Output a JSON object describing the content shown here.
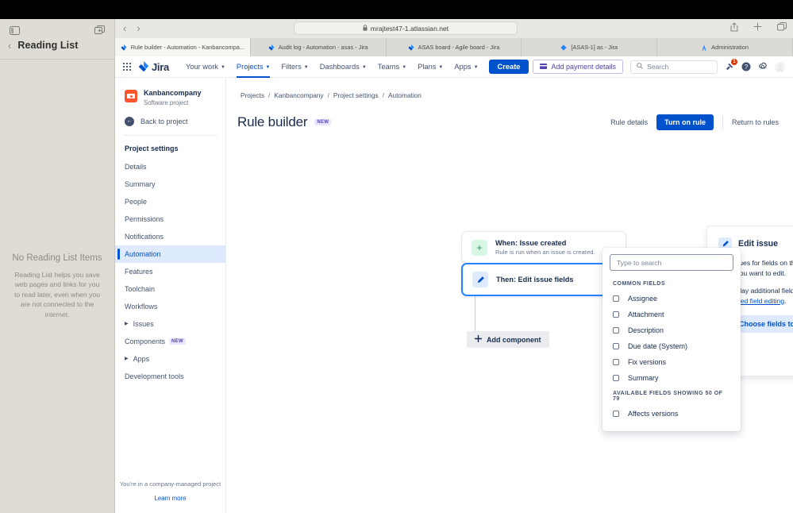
{
  "browser": {
    "sidebar": {
      "toolbar_icons": [
        "sidebar-toggle-icon",
        "new-tab-group-icon"
      ],
      "back_glyph": "‹",
      "title": "Reading List",
      "empty_title": "No Reading List Items",
      "empty_body": "Reading List helps you save web pages and links for you to read later, even when you are not connected to the internet."
    },
    "nav": {
      "back_glyph": "‹",
      "forward_glyph": "›",
      "reload_glyph": "↻"
    },
    "url": {
      "lock": "🔒",
      "value": "mrajtest47-1.atlassian.net"
    },
    "right_icons": [
      "share-icon",
      "new-tab-icon",
      "tab-overview-icon"
    ],
    "tabs": [
      {
        "title": "Rule builder - Automation - Kanbancompa...",
        "favicon": "jira",
        "active": true
      },
      {
        "title": "Audit log - Automation - asas - Jira",
        "favicon": "jira",
        "active": false
      },
      {
        "title": "ASAS board - Agile board - Jira",
        "favicon": "jira",
        "active": false
      },
      {
        "title": "[ASAS-1] as - Jira",
        "favicon": "issue",
        "active": false
      },
      {
        "title": "Administration",
        "favicon": "admin",
        "active": false
      }
    ]
  },
  "jira": {
    "topnav": {
      "product": "Jira",
      "items": [
        {
          "label": "Your work",
          "caret": true,
          "selected": false
        },
        {
          "label": "Projects",
          "caret": true,
          "selected": true
        },
        {
          "label": "Filters",
          "caret": true,
          "selected": false
        },
        {
          "label": "Dashboards",
          "caret": true,
          "selected": false
        },
        {
          "label": "Teams",
          "caret": true,
          "selected": false
        },
        {
          "label": "Plans",
          "caret": true,
          "selected": false
        },
        {
          "label": "Apps",
          "caret": true,
          "selected": false
        }
      ],
      "create_label": "Create",
      "payment_label": "Add payment details",
      "search_placeholder": "Search",
      "notification_count": "1",
      "right_icons": [
        "notifications-icon",
        "help-icon",
        "settings-icon",
        "avatar"
      ]
    },
    "sidebar": {
      "project_name": "Kanbancompany",
      "project_type": "Software project",
      "back_label": "Back to project",
      "section_title": "Project settings",
      "items": [
        {
          "label": "Details",
          "active": false,
          "expandable": false,
          "badge": ""
        },
        {
          "label": "Summary",
          "active": false,
          "expandable": false,
          "badge": ""
        },
        {
          "label": "People",
          "active": false,
          "expandable": false,
          "badge": ""
        },
        {
          "label": "Permissions",
          "active": false,
          "expandable": false,
          "badge": ""
        },
        {
          "label": "Notifications",
          "active": false,
          "expandable": false,
          "badge": ""
        },
        {
          "label": "Automation",
          "active": true,
          "expandable": false,
          "badge": ""
        },
        {
          "label": "Features",
          "active": false,
          "expandable": false,
          "badge": ""
        },
        {
          "label": "Toolchain",
          "active": false,
          "expandable": false,
          "badge": ""
        },
        {
          "label": "Workflows",
          "active": false,
          "expandable": false,
          "badge": ""
        },
        {
          "label": "Issues",
          "active": false,
          "expandable": true,
          "badge": ""
        },
        {
          "label": "Components",
          "active": false,
          "expandable": false,
          "badge": "NEW"
        },
        {
          "label": "Apps",
          "active": false,
          "expandable": true,
          "badge": ""
        },
        {
          "label": "Development tools",
          "active": false,
          "expandable": false,
          "badge": ""
        }
      ],
      "footer_note": "You're in a company-managed project",
      "footer_link": "Learn more"
    },
    "breadcrumb": [
      "Projects",
      "Kanbancompany",
      "Project settings",
      "Automation"
    ],
    "page": {
      "title": "Rule builder",
      "title_badge": "NEW",
      "actions": {
        "rule_details": "Rule details",
        "turn_on_rule": "Turn on rule",
        "return_to_rules": "Return to rules"
      }
    },
    "canvas": {
      "trigger": {
        "title": "When: Issue created",
        "subtitle": "Rule is run when an issue is created.",
        "icon": "plus-icon"
      },
      "action": {
        "title": "Then: Edit issue fields",
        "icon": "pencil-icon"
      },
      "add_component": "Add component"
    },
    "panel": {
      "title": "Edit issue",
      "icon": "pencil-icon",
      "header_actions": [
        "duplicate-icon",
        "delete-icon",
        "help-icon"
      ],
      "description_1": "Set values for fields on the issue. Simply add the fields you want to edit.",
      "description_2_pre": "To display additional fields, select 'More options' for ",
      "description_2_link": "advanced field editing",
      "description_2_post": ".",
      "choose_fields_label": "Choose fields to set...",
      "choose_fields_icon": "gear-icon"
    },
    "dropdown": {
      "search_placeholder": "Type to search",
      "search_icon": "none",
      "groups": [
        {
          "heading": "COMMON FIELDS",
          "items": [
            {
              "label": "Assignee",
              "checked": false
            },
            {
              "label": "Attachment",
              "checked": false
            },
            {
              "label": "Description",
              "checked": false
            },
            {
              "label": "Due date (System)",
              "checked": false
            },
            {
              "label": "Fix versions",
              "checked": false
            },
            {
              "label": "Summary",
              "checked": false
            }
          ]
        },
        {
          "heading": "AVAILABLE FIELDS SHOWING 50 OF 79",
          "items": [
            {
              "label": "Affects versions",
              "checked": false
            }
          ]
        }
      ]
    }
  },
  "colors": {
    "brand_blue": "#0052cc",
    "accent_blue": "#2684ff",
    "purple": "#5243aa",
    "danger_red": "#de350b",
    "green": "#1f9254",
    "text_dark": "#172b4d",
    "text_sub": "#6b778c"
  }
}
